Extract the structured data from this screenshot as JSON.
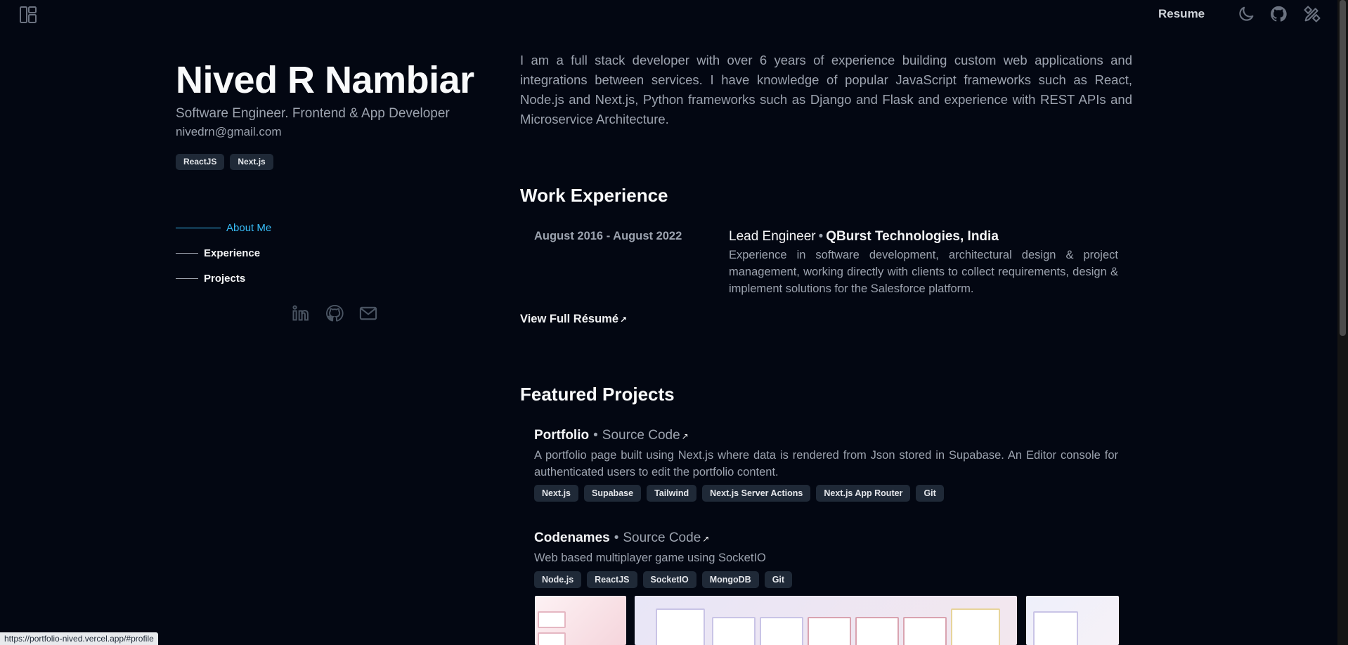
{
  "topbar": {
    "resume_label": "Resume",
    "icons": [
      "layout-icon",
      "moon-icon",
      "github-icon",
      "editor-icon"
    ]
  },
  "profile": {
    "name": "Nived R Nambiar",
    "subtitle": "Software Engineer. Frontend & App Developer",
    "email": "nivedrn@gmail.com",
    "tags": [
      "ReactJS",
      "Next.js"
    ]
  },
  "nav": {
    "items": [
      {
        "label": "About Me",
        "active": true
      },
      {
        "label": "Experience",
        "active": false
      },
      {
        "label": "Projects",
        "active": false
      }
    ]
  },
  "socials": [
    "linkedin-icon",
    "github-icon",
    "mail-icon"
  ],
  "about": {
    "text": "I am a full stack developer with over 6 years of experience building custom web applications and integrations between services. I have knowledge of popular JavaScript frameworks such as React, Node.js and Next.js, Python frameworks such as Django and Flask and experience with REST APIs and Microservice Architecture."
  },
  "experience": {
    "title": "Work Experience",
    "items": [
      {
        "date": "August 2016 - August 2022",
        "role": "Lead Engineer",
        "separator": "•",
        "company": "QBurst Technologies, India",
        "description": "Experience in software development, architectural design & project management, working directly with clients to collect requirements, design & implement solutions for the Salesforce platform."
      }
    ],
    "resume_link": "View Full Résumé",
    "arrow": "↗"
  },
  "projects": {
    "title": "Featured Projects",
    "items": [
      {
        "name": "Portfolio",
        "separator": "•",
        "source_label": "Source Code",
        "arrow": "↗",
        "description": "A portfolio page built using Next.js where data is rendered from Json stored in Supabase. An Editor console for authenticated users to edit the portfolio content.",
        "tags": [
          "Next.js",
          "Supabase",
          "Tailwind",
          "Next.js Server Actions",
          "Next.js App Router",
          "Git"
        ]
      },
      {
        "name": "Codenames",
        "separator": "•",
        "source_label": "Source Code",
        "arrow": "↗",
        "description": "Web based multiplayer game using SocketIO",
        "tags": [
          "Node.js",
          "ReactJS",
          "SocketIO",
          "MongoDB",
          "Git"
        ]
      }
    ]
  },
  "status_bar": {
    "url": "https://portfolio-nived.vercel.app/#profile"
  },
  "colors": {
    "background": "#030712",
    "accent": "#38bdf8",
    "chip_bg": "#1f2937",
    "muted_text": "#9ca3af"
  }
}
